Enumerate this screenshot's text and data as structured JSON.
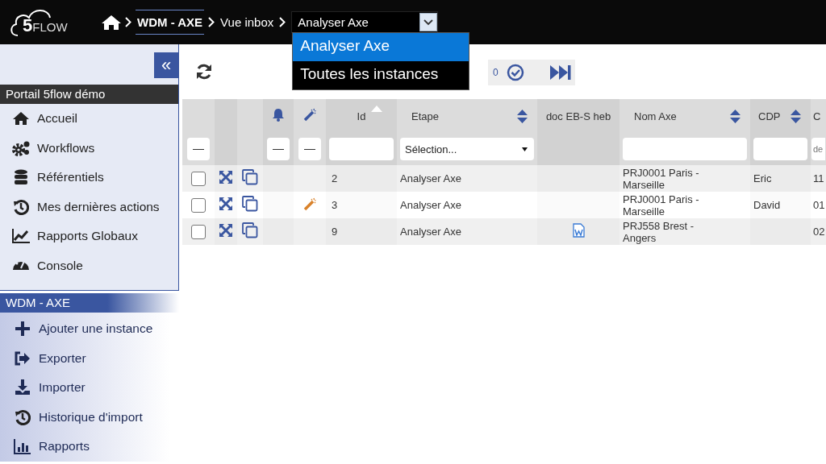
{
  "header": {
    "logo": {
      "digit": "5",
      "word": "FLOW"
    },
    "breadcrumbs": [
      {
        "label": "WDM - AXE",
        "current": true
      },
      {
        "label": "Vue inbox",
        "current": false
      }
    ],
    "view_select": {
      "value": "Analyser Axe",
      "expanded": true,
      "options": [
        {
          "label": "Analyser Axe",
          "selected": true
        },
        {
          "label": "Toutes les instances",
          "selected": false
        }
      ]
    }
  },
  "sidebar": {
    "collapse_label": "«",
    "sections": [
      {
        "title": "Portail 5flow démo",
        "items": [
          {
            "label": "Accueil"
          },
          {
            "label": "Workflows"
          },
          {
            "label": "Référentiels"
          },
          {
            "label": "Mes dernières actions"
          },
          {
            "label": "Rapports Globaux"
          },
          {
            "label": "Console"
          }
        ]
      },
      {
        "title": "WDM - AXE",
        "items": [
          {
            "label": "Ajouter une instance"
          },
          {
            "label": "Exporter"
          },
          {
            "label": "Importer"
          },
          {
            "label": "Historique d'import"
          },
          {
            "label": "Rapports"
          }
        ]
      }
    ]
  },
  "toolbar": {
    "counter": "0"
  },
  "table": {
    "columns": [
      {
        "kind": "check",
        "filter_value": "—"
      },
      {
        "kind": "expand"
      },
      {
        "kind": "copy"
      },
      {
        "kind": "bell",
        "filter_value": "—"
      },
      {
        "kind": "wand",
        "filter_value": "—"
      },
      {
        "kind": "text",
        "label": "Id"
      },
      {
        "kind": "text",
        "label": "Etape",
        "filter_value": "Sélection..."
      },
      {
        "kind": "doc",
        "label": "doc EB-S heb"
      },
      {
        "kind": "text",
        "label": "Nom Axe"
      },
      {
        "kind": "text",
        "label": "CDP"
      },
      {
        "kind": "text",
        "label": "C",
        "placeholder": "de"
      }
    ],
    "rows": [
      {
        "checked": false,
        "wand": false,
        "doc": false,
        "id": "2",
        "etape": "Analyser Axe",
        "nom_axe": "PRJ0001 Paris - Marseille",
        "cdp": "Eric",
        "column_11": "11"
      },
      {
        "checked": false,
        "wand": true,
        "doc": false,
        "id": "3",
        "etape": "Analyser Axe",
        "nom_axe": "PRJ0001 Paris - Marseille",
        "cdp": "David",
        "column_11": "01"
      },
      {
        "checked": false,
        "wand": false,
        "doc": true,
        "id": "9",
        "etape": "Analyser Axe",
        "nom_axe": "PRJ558 Brest - Angers",
        "column_11": "02"
      }
    ]
  }
}
